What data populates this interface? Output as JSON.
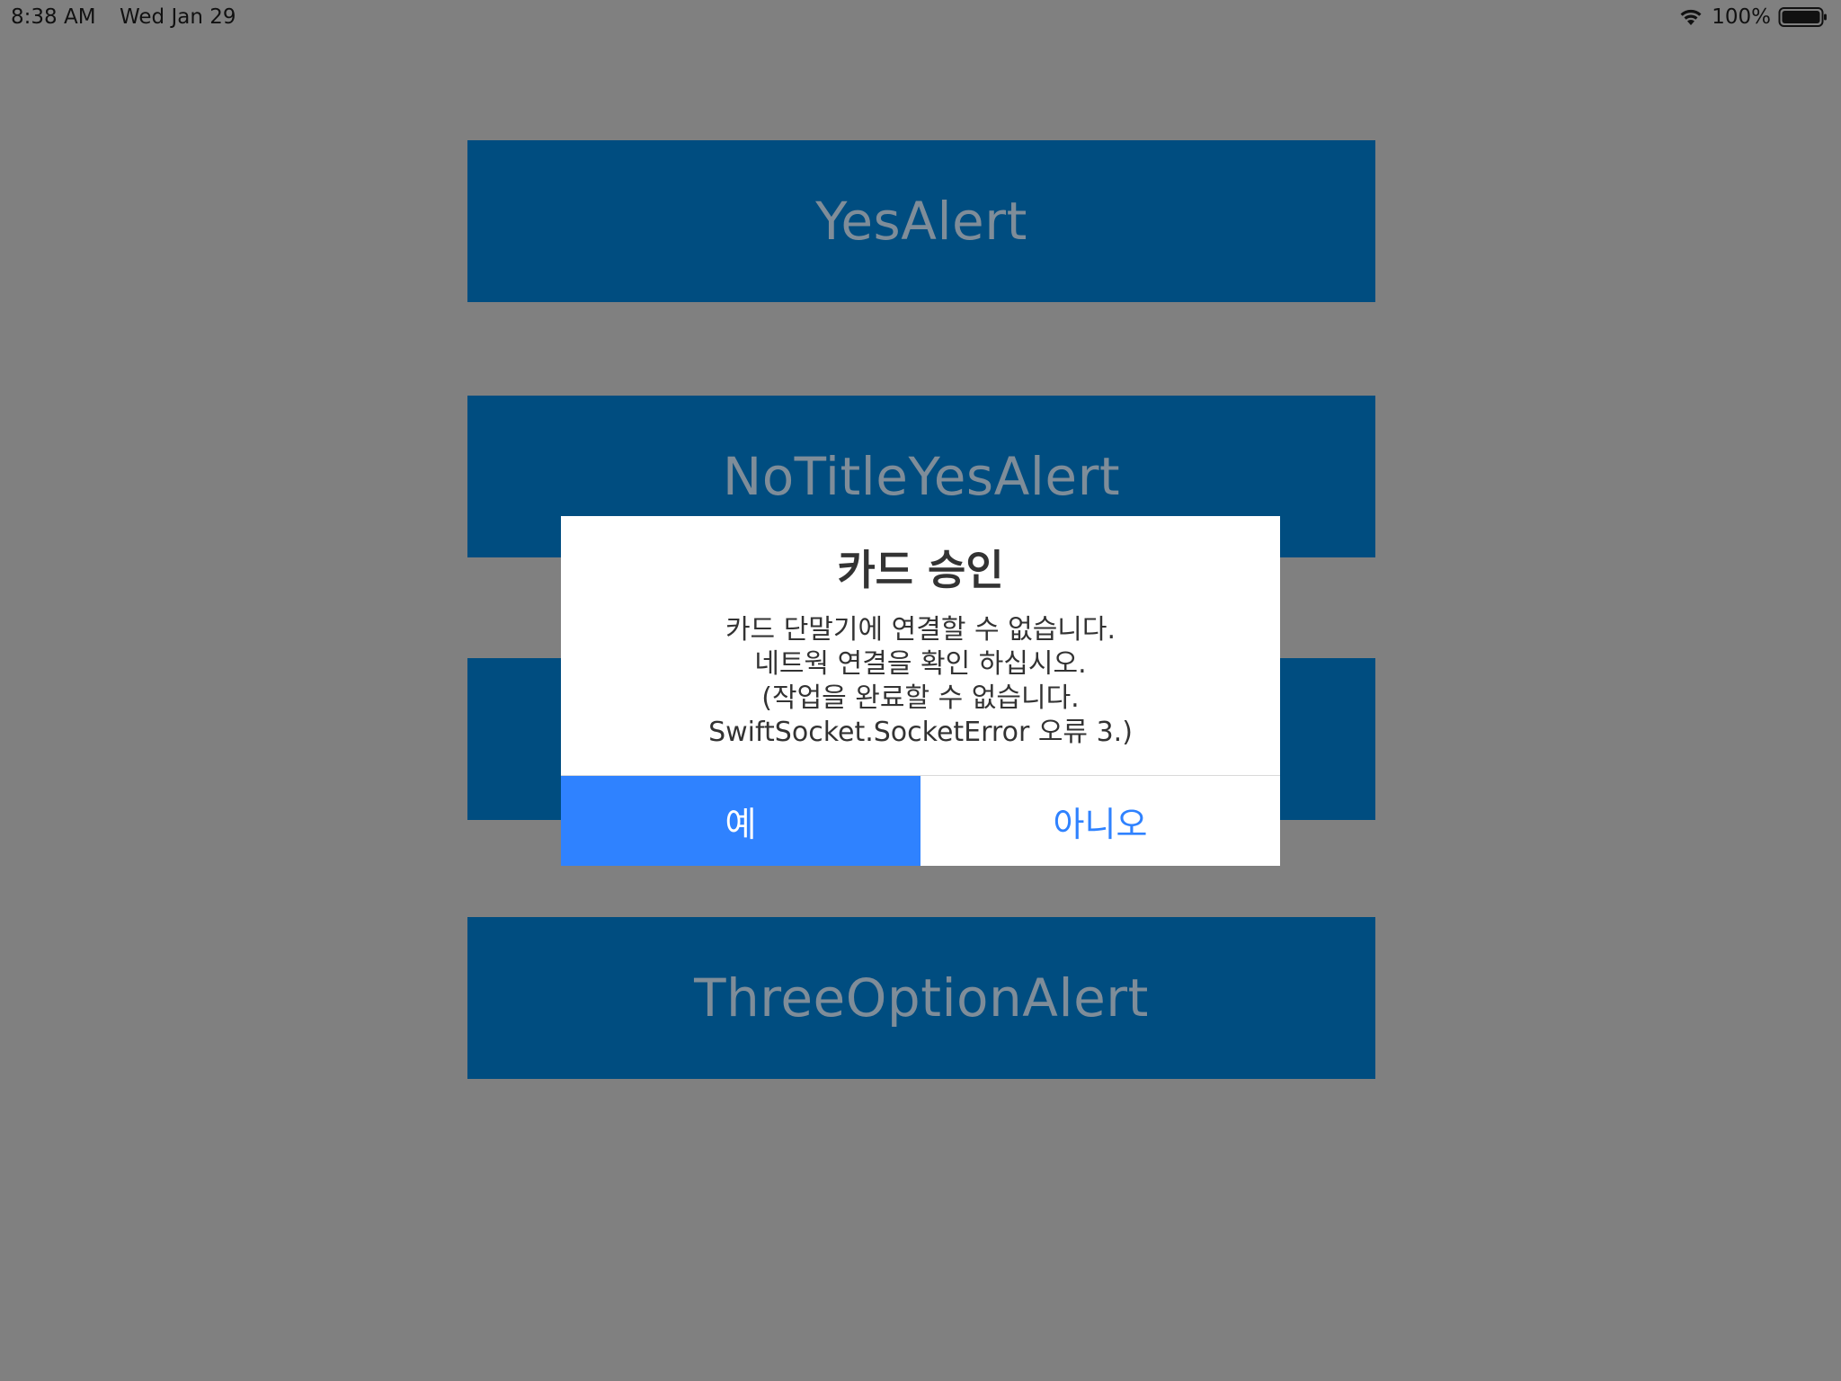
{
  "status_bar": {
    "time": "8:38 AM",
    "date": "Wed Jan 29",
    "battery": "100%",
    "wifi_icon": "wifi-icon",
    "battery_icon": "battery-icon"
  },
  "buttons": [
    {
      "label": "YesAlert"
    },
    {
      "label": "NoTitleYesAlert"
    },
    {
      "label": ""
    },
    {
      "label": "ThreeOptionAlert"
    }
  ],
  "dialog": {
    "title": "카드 승인",
    "message_lines": [
      "카드 단말기에 연결할 수 없습니다.",
      "네트웍 연결을 확인 하십시오.",
      "(작업을 완료할 수 없습니다.",
      "SwiftSocket.SocketError 오류 3.)"
    ],
    "yes_label": "예",
    "no_label": "아니오"
  },
  "colors": {
    "background": "#808080",
    "button_bg": "#004d80",
    "button_text": "#7f8d99",
    "accent": "#2f82ff",
    "dialog_bg": "#ffffff"
  }
}
